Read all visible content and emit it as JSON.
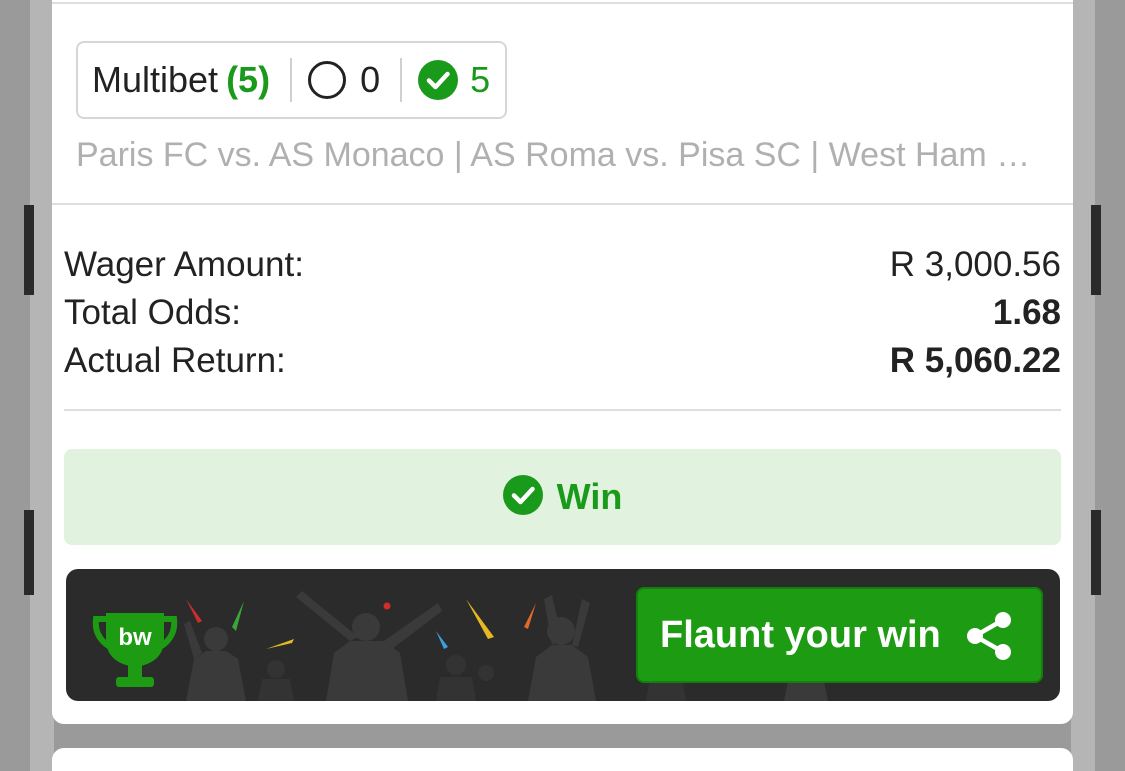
{
  "bet": {
    "type_label": "Multibet",
    "selections_count": "(5)",
    "open_count": "0",
    "won_count": "5",
    "matches": "Paris FC vs. AS Monaco | AS Roma vs. Pisa SC | West Ham …"
  },
  "summary": {
    "wager_label": "Wager Amount:",
    "wager_value": "R 3,000.56",
    "odds_label": "Total Odds:",
    "odds_value": "1.68",
    "return_label": "Actual Return:",
    "return_value": "R 5,060.22"
  },
  "status": {
    "label": "Win",
    "color": "#1a9a1a"
  },
  "promo": {
    "logo_text": "bw",
    "button_label": "Flaunt your win",
    "button_color": "#1d9b12",
    "icons": [
      "trophy-icon",
      "share-icon",
      "check-circle-icon",
      "circle-outline-icon"
    ]
  }
}
